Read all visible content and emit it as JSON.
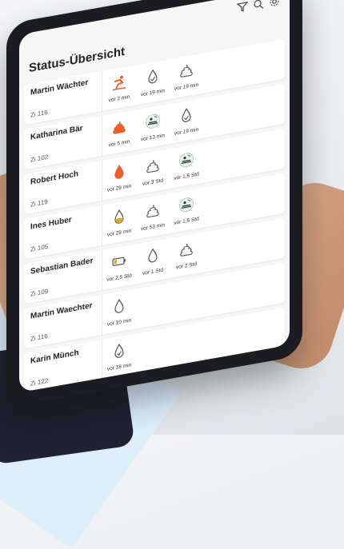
{
  "header": {
    "title": "Status-Übersicht",
    "icons": [
      "filter-icon",
      "search-icon",
      "gear-icon"
    ]
  },
  "rows": [
    {
      "name": "Martin Wächter",
      "room": "Zi 116",
      "statuses": [
        {
          "icon": "fall-alert-icon",
          "time": "vor 2 min",
          "color": "#e8602c"
        },
        {
          "icon": "drop-check-icon",
          "time": "vor 19 min",
          "color": "#555555"
        },
        {
          "icon": "stool-icon",
          "time": "vor 19 min",
          "color": "#555555"
        }
      ]
    },
    {
      "name": "Katharina Bär",
      "room": "Zi 102",
      "statuses": [
        {
          "icon": "stool-icon",
          "time": "vor 5 min",
          "color": "#e8602c"
        },
        {
          "icon": "bed-position-icon",
          "time": "vor 13 min",
          "color": "#555555"
        },
        {
          "icon": "drop-check-icon",
          "time": "vor 19 min",
          "color": "#555555"
        }
      ]
    },
    {
      "name": "Robert Hoch",
      "room": "Zi 119",
      "statuses": [
        {
          "icon": "drop-icon",
          "time": "vor 29 min",
          "color": "#e8602c"
        },
        {
          "icon": "stool-icon",
          "time": "vor 3 Std",
          "color": "#555555"
        },
        {
          "icon": "bed-position-icon",
          "time": "vor 1,5 Std",
          "color": "#555555"
        }
      ]
    },
    {
      "name": "Ines Huber",
      "room": "Zi 105",
      "statuses": [
        {
          "icon": "drop-half-icon",
          "time": "vor 29 min",
          "color": "#e0a92b"
        },
        {
          "icon": "stool-icon",
          "time": "vor 53 min",
          "color": "#555555"
        },
        {
          "icon": "bed-position-icon",
          "time": "vor 1,5 Std",
          "color": "#555555"
        }
      ]
    },
    {
      "name": "Sebastian Bader",
      "room": "Zi 109",
      "statuses": [
        {
          "icon": "battery-low-icon",
          "time": "vor 2,5 Std",
          "color": "#e0a92b"
        },
        {
          "icon": "drop-icon",
          "time": "vor 1 Std",
          "color": "#555555"
        },
        {
          "icon": "stool-icon",
          "time": "vor 2 Std",
          "color": "#555555"
        }
      ]
    },
    {
      "name": "Martin Waechter",
      "room": "Zi 116",
      "statuses": [
        {
          "icon": "drop-icon",
          "time": "vor 10 min",
          "color": "#555555"
        }
      ]
    },
    {
      "name": "Karin Münch",
      "room": "Zi 122",
      "statuses": [
        {
          "icon": "drop-check-icon",
          "time": "vor 18 min",
          "color": "#555555"
        }
      ]
    }
  ]
}
